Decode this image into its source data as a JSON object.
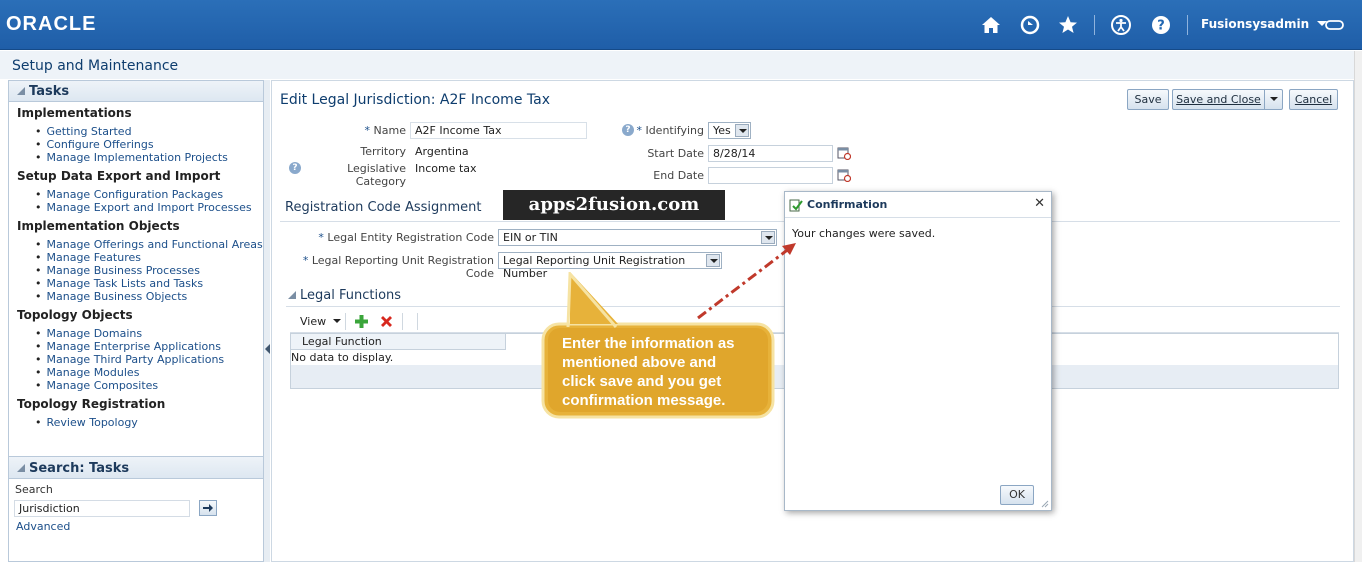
{
  "header": {
    "logo": "ORACLE",
    "user": "Fusionsysadmin",
    "icons": [
      "home-icon",
      "navigator-icon",
      "favorites-icon",
      "accessibility-icon",
      "help-icon",
      "sign-out-icon"
    ]
  },
  "page": {
    "title": "Setup and Maintenance"
  },
  "tasks": {
    "title": "Tasks",
    "groups": [
      {
        "name": "Implementations",
        "items": [
          "Getting Started",
          "Configure Offerings",
          "Manage Implementation Projects"
        ]
      },
      {
        "name": "Setup Data Export and Import",
        "items": [
          "Manage Configuration Packages",
          "Manage Export and Import Processes"
        ]
      },
      {
        "name": "Implementation Objects",
        "items": [
          "Manage Offerings and Functional Areas",
          "Manage Features",
          "Manage Business Processes",
          "Manage Task Lists and Tasks",
          "Manage Business Objects"
        ]
      },
      {
        "name": "Topology Objects",
        "items": [
          "Manage Domains",
          "Manage Enterprise Applications",
          "Manage Third Party Applications",
          "Manage Modules",
          "Manage Composites"
        ]
      },
      {
        "name": "Topology Registration",
        "items": [
          "Review Topology"
        ]
      }
    ]
  },
  "search": {
    "title": "Search: Tasks",
    "label": "Search",
    "value": "Jurisdiction",
    "advanced": "Advanced"
  },
  "form": {
    "title": "Edit Legal Jurisdiction: A2F Income Tax",
    "buttons": {
      "save": "Save",
      "save_close": "Save and Close",
      "cancel": "Cancel"
    },
    "name_label": "Name",
    "name_value": "A2F Income Tax",
    "territory_label": "Territory",
    "territory_value": "Argentina",
    "category_label": "Legislative Category",
    "category_value": "Income tax",
    "identifying_label": "Identifying",
    "identifying_value": "Yes",
    "start_label": "Start Date",
    "start_value": "8/28/14",
    "end_label": "End Date",
    "end_value": ""
  },
  "registration": {
    "title": "Registration Code Assignment",
    "entity_label": "Legal Entity Registration Code",
    "entity_value": "EIN or TIN",
    "unit_label": "Legal Reporting Unit Registration Code",
    "unit_value": "Legal Reporting Unit Registration Number"
  },
  "legal_functions": {
    "title": "Legal Functions",
    "view": "View",
    "column": "Legal Function",
    "empty": "No data to display."
  },
  "watermark": "apps2fusion.com",
  "callout": {
    "lines": [
      "Enter the information as",
      "mentioned above and",
      "click save and you get",
      "confirmation message."
    ]
  },
  "dialog": {
    "title": "Confirmation",
    "message": "Your changes were saved.",
    "ok": "OK"
  }
}
